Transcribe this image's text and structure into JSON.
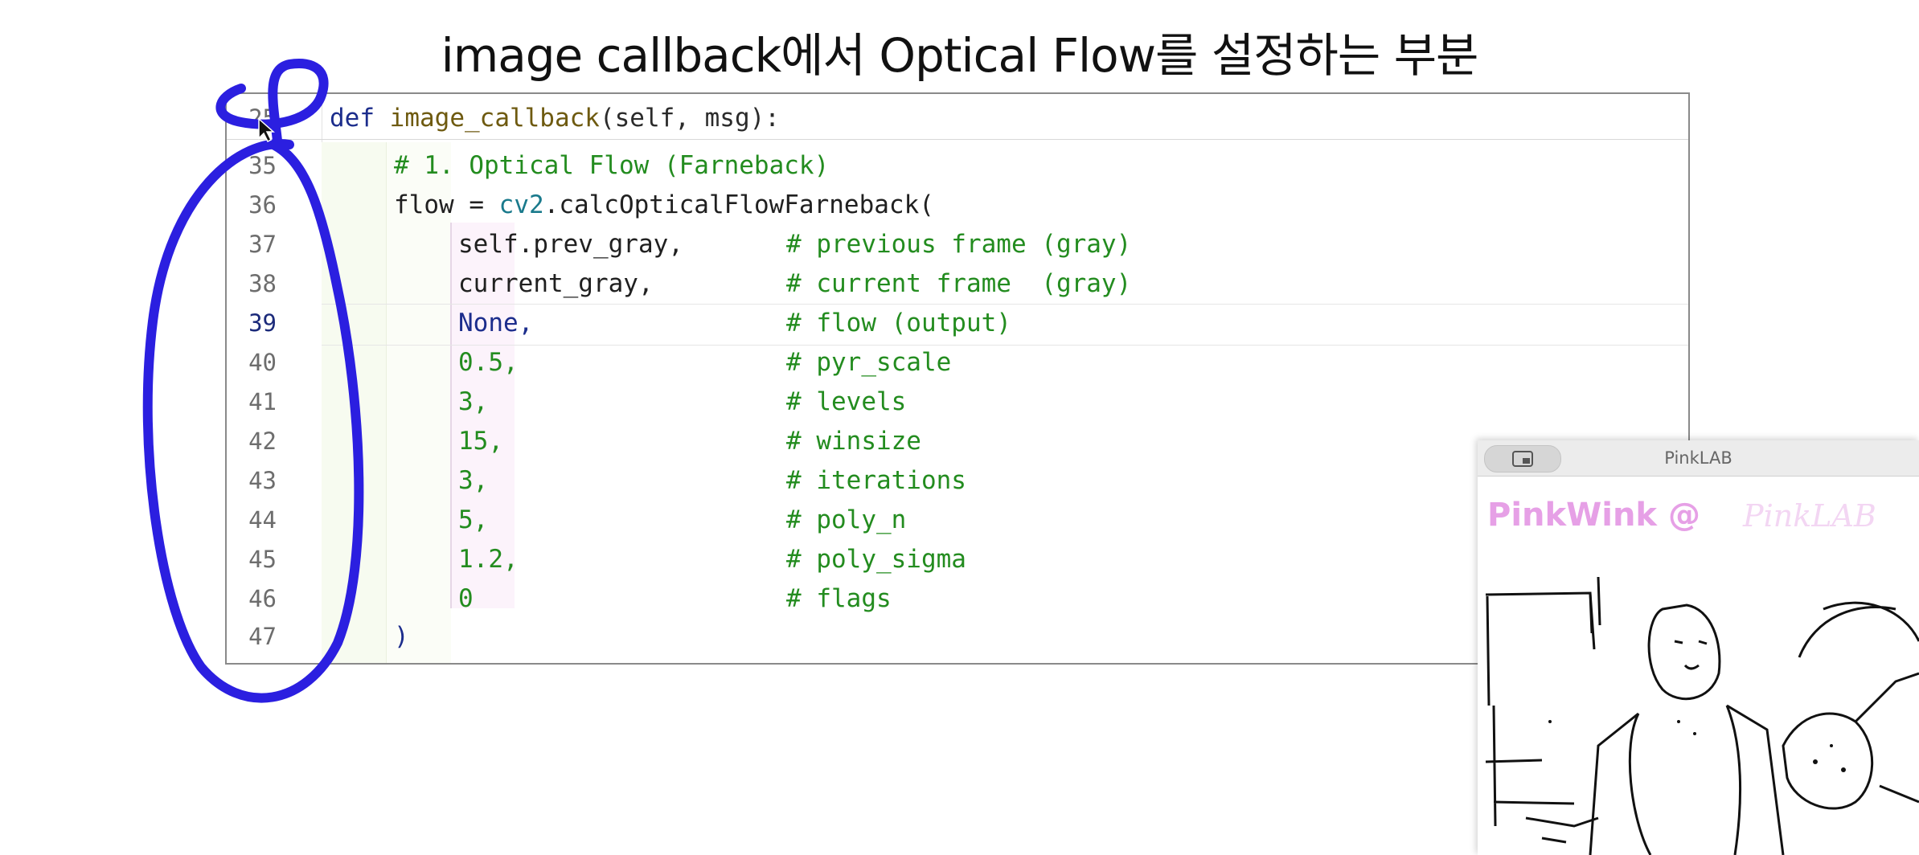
{
  "slide": {
    "title": "image callback에서 Optical Flow를 설정하는 부분"
  },
  "editor": {
    "lines": [
      {
        "num": "25",
        "active": false
      },
      {
        "num": "35",
        "active": false
      },
      {
        "num": "36",
        "active": false
      },
      {
        "num": "37",
        "active": false
      },
      {
        "num": "38",
        "active": false
      },
      {
        "num": "39",
        "active": true
      },
      {
        "num": "40",
        "active": false
      },
      {
        "num": "41",
        "active": false
      },
      {
        "num": "42",
        "active": false
      },
      {
        "num": "43",
        "active": false
      },
      {
        "num": "44",
        "active": false
      },
      {
        "num": "45",
        "active": false
      },
      {
        "num": "46",
        "active": false
      },
      {
        "num": "47",
        "active": false
      }
    ],
    "code": {
      "def_kw": "def",
      "def_name": "image_callback",
      "def_args": "(self, msg):",
      "comment_header": "# 1. Optical Flow (Farneback)",
      "flow_assign": "flow = ",
      "cv_module": "cv2",
      "cv_call": ".calcOpticalFlowFarneback(",
      "args": [
        {
          "value": "self.prev_gray,",
          "comment": "# previous frame (gray)"
        },
        {
          "value": "current_gray,",
          "comment": "# current frame  (gray)"
        },
        {
          "value": "None,",
          "comment": "# flow (output)"
        },
        {
          "value": "0.5,",
          "comment": "# pyr_scale"
        },
        {
          "value": "3,",
          "comment": "# levels"
        },
        {
          "value": "15,",
          "comment": "# winsize"
        },
        {
          "value": "3,",
          "comment": "# iterations"
        },
        {
          "value": "5,",
          "comment": "# poly_n"
        },
        {
          "value": "1.2,",
          "comment": "# poly_sigma"
        },
        {
          "value": "0",
          "comment": "# flags"
        }
      ],
      "close_paren": ")"
    }
  },
  "preview": {
    "title": "PinkLAB",
    "watermark": "PinkWink @",
    "watermark_script": "PinkLAB"
  },
  "colors": {
    "keyword": "#1c2d8c",
    "comment": "#238c1f",
    "annotation_pen": "#2b1fe0",
    "watermark": "#e6a0e6"
  }
}
